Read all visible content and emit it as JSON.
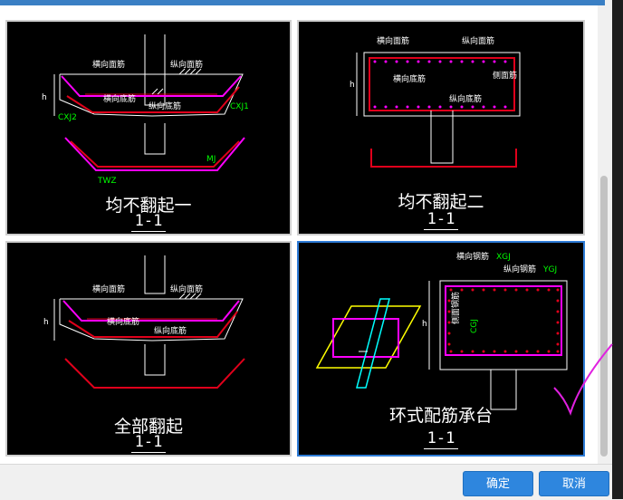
{
  "tiles": [
    {
      "caption": "均不翻起一",
      "section": "1-1",
      "labels": {
        "heng_mian": "横向面筋",
        "zong_mian": "纵向面筋",
        "heng_di": "横向底筋",
        "zong_di": "纵向底筋",
        "wz": "TWZ",
        "cxj2": "CXJ2",
        "cxj1": "CXJ1",
        "mj": "MJ",
        "h": "h"
      }
    },
    {
      "caption": "均不翻起二",
      "section": "1-1",
      "labels": {
        "heng_mian": "横向面筋",
        "zong_mian": "纵向面筋",
        "heng_di": "横向底筋",
        "zong_di": "纵向底筋",
        "side": "侧面筋",
        "h": "h"
      }
    },
    {
      "caption": "全部翻起",
      "section": "1-1",
      "labels": {
        "heng_mian": "横向面筋",
        "zong_mian": "纵向面筋",
        "heng_di": "横向底筋",
        "zong_di": "纵向底筋",
        "h": "h"
      }
    },
    {
      "caption": "环式配筋承台",
      "section": "1-1",
      "labels": {
        "heng": "横向钢筋",
        "heng_code": "XGJ",
        "zong": "纵向钢筋",
        "zong_code": "YGJ",
        "side": "侧面钢筋",
        "cgj": "CGJ",
        "h": "h"
      }
    }
  ],
  "buttons": {
    "ok": "确定",
    "cancel": "取消"
  },
  "colors": {
    "accent": "#2e86de",
    "rebar_red": "#e0001b",
    "rebar_magenta": "#ff00ff",
    "label_green": "#00ff00",
    "check_mark": "#e020e0"
  }
}
